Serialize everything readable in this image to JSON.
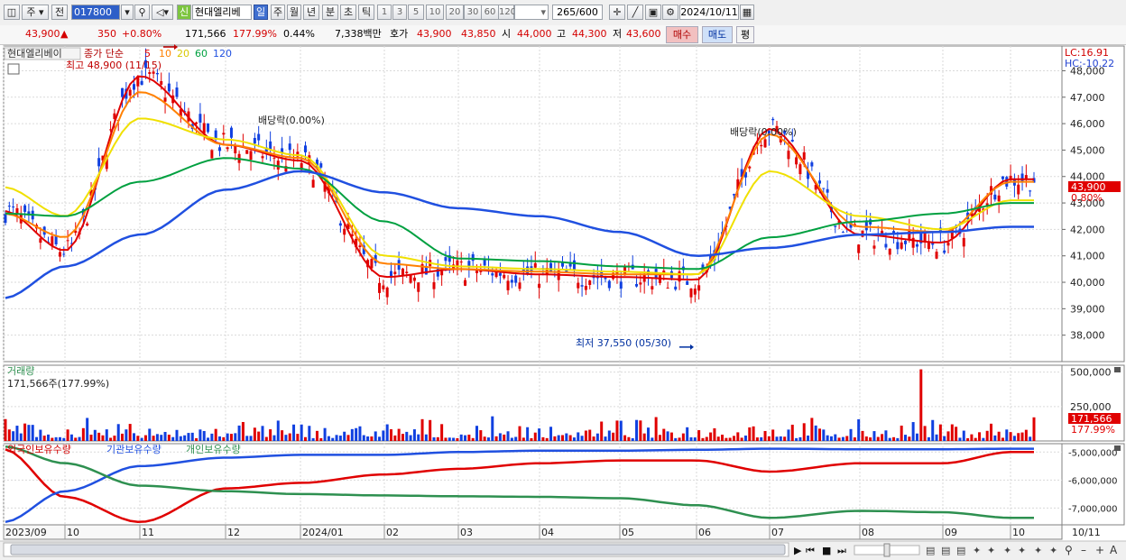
{
  "toolbar": {
    "period_btn": "주",
    "prev_btn": "전",
    "code": "017800",
    "name_badge": "신",
    "name": "현대엘리베",
    "tabs": [
      "일",
      "주",
      "월",
      "년",
      "분",
      "초",
      "틱"
    ],
    "active_tab": "일",
    "intervals": [
      "1",
      "3",
      "5",
      "10",
      "20",
      "30",
      "60",
      "120"
    ],
    "count_value": "265",
    "count_total": "/600",
    "date": "2024/10/11"
  },
  "quote": {
    "price": "43,900",
    "change": "350",
    "rate": "+0.80%",
    "volume": "171,566",
    "vol_rate": "177.99%",
    "turnover": "0.44%",
    "amount": "7,338백만",
    "hoga_label": "호가",
    "ask": "43,900",
    "bid": "43,850",
    "open_label": "시",
    "open": "44,000",
    "high_label": "고",
    "high": "44,300",
    "low_label": "저",
    "low": "43,600",
    "buy_btn": "매수",
    "sell_btn": "매도",
    "eval_btn": "평"
  },
  "price_panel": {
    "title": "현대엘리베이",
    "legend_label": "종가 단순",
    "legend_periods": [
      "5",
      "10",
      "20",
      "60",
      "120"
    ],
    "lc": "LC:16.91",
    "hc": "HC:-10.22",
    "price_tag": "43,900",
    "rate_tag": "0.80%",
    "max_label": "최고 48,900 (11/15)",
    "min_label": "최저 37,550 (05/30)",
    "dividend_labels": [
      "배당락(0.00%)",
      "배당락(0.00%)"
    ]
  },
  "volume_panel": {
    "title": "거래량",
    "info": "171,566주(177.99%)",
    "tag_value": "171,566",
    "tag_rate": "177.99%"
  },
  "holdings_panel": {
    "legend": [
      "외국인보유수량",
      "기관보유수량",
      "개인보유수량"
    ]
  },
  "x_axis": {
    "labels": [
      "2023/09",
      "10",
      "11",
      "12",
      "2024/01",
      "02",
      "03",
      "04",
      "05",
      "06",
      "07",
      "08",
      "09",
      "10"
    ],
    "right_label": "10/11"
  },
  "colors": {
    "up": "#e00000",
    "down": "#1040e0",
    "ma5": "#e00000",
    "ma10": "#ff8000",
    "ma20": "#f0e000",
    "ma60": "#00a040",
    "ma120": "#2050e0",
    "foreign": "#e00000",
    "institution": "#2050e0",
    "individual": "#2e9050"
  },
  "chart_data": [
    {
      "type": "line",
      "title": "",
      "ylabel": "",
      "x": [
        "2023/09",
        "10",
        "11",
        "12",
        "2024/01",
        "02",
        "03",
        "04",
        "05",
        "06",
        "07",
        "08",
        "09",
        "10"
      ],
      "y_ticks": [
        "38,000",
        "39,000",
        "40,000",
        "41,000",
        "42,000",
        "43,000",
        "44,000",
        "45,000",
        "46,000",
        "47,000",
        "48,000"
      ],
      "ylim": [
        37000,
        48800
      ],
      "series": [
        {
          "name": "5",
          "values": [
            42700,
            41200,
            47800,
            45200,
            44600,
            40200,
            40500,
            40300,
            40200,
            40100,
            45800,
            41800,
            41500,
            43900
          ]
        },
        {
          "name": "10",
          "values": [
            42600,
            41700,
            47200,
            45200,
            44700,
            40700,
            40500,
            40400,
            40300,
            40300,
            45600,
            42100,
            41900,
            43800
          ]
        },
        {
          "name": "20",
          "values": [
            43600,
            42500,
            46200,
            45400,
            44800,
            41000,
            40600,
            40500,
            40400,
            40300,
            44200,
            42500,
            42000,
            43100
          ]
        },
        {
          "name": "60",
          "values": [
            42600,
            42500,
            43800,
            44700,
            44300,
            42300,
            40900,
            40800,
            40600,
            40500,
            41700,
            42300,
            42600,
            43000
          ]
        },
        {
          "name": "120",
          "values": [
            39400,
            40600,
            41800,
            43500,
            44200,
            43400,
            42800,
            42500,
            41900,
            41000,
            41300,
            41800,
            41900,
            42100
          ]
        }
      ],
      "markers": [
        {
          "text": "최고 48,900 (11/15)",
          "x": "11",
          "y": 48900
        },
        {
          "text": "최저 37,550 (05/30)",
          "x": "05",
          "y": 37550
        }
      ]
    },
    {
      "type": "bar",
      "title": "거래량",
      "y_ticks": [
        "250,000",
        "500,000"
      ],
      "ylim": [
        0,
        550000
      ],
      "last_value": 171566
    },
    {
      "type": "line",
      "title": "보유수량",
      "y_ticks": [
        "-5,000,000",
        "-6,000,000",
        "-7,000,000"
      ],
      "ylim": [
        -7600000,
        -4700000
      ],
      "series": [
        {
          "name": "외국인보유수량",
          "values": [
            -4900000,
            -6600000,
            -7500000,
            -6300000,
            -6100000,
            -5800000,
            -5600000,
            -5400000,
            -5300000,
            -5300000,
            -5700000,
            -5400000,
            -5400000,
            -5000000
          ]
        },
        {
          "name": "기관보유수량",
          "values": [
            -7500000,
            -6400000,
            -5500000,
            -5200000,
            -5100000,
            -5100000,
            -5000000,
            -4950000,
            -4950000,
            -4920000,
            -4880000,
            -4900000,
            -4900000,
            -4880000
          ]
        },
        {
          "name": "개인보유수량",
          "values": [
            -4800000,
            -5400000,
            -6200000,
            -6400000,
            -6500000,
            -6550000,
            -6580000,
            -6600000,
            -6650000,
            -6900000,
            -7350000,
            -7100000,
            -7150000,
            -7350000
          ]
        }
      ]
    }
  ]
}
